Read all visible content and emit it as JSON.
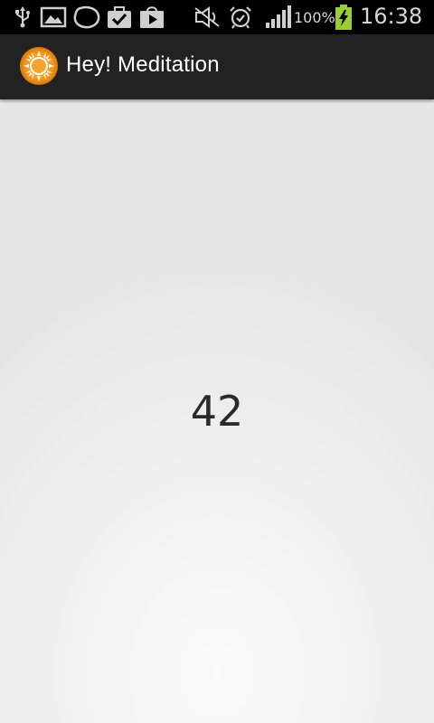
{
  "status_bar": {
    "icons": [
      "usb-icon",
      "image-icon",
      "blob-icon",
      "briefcase-check-icon",
      "play-store-icon",
      "mute-icon",
      "alarm-icon",
      "signal-icon",
      "battery-charging-icon"
    ],
    "battery_percent": "100%",
    "time": "16:38"
  },
  "action_bar": {
    "app_icon": "sun-icon",
    "title": "Hey! Meditation"
  },
  "main": {
    "counter_value": "42"
  },
  "colors": {
    "action_bar_bg": "#222222",
    "status_bar_bg": "#000000",
    "battery_green": "#9acd32",
    "icon_orange": "#f39a1e"
  }
}
